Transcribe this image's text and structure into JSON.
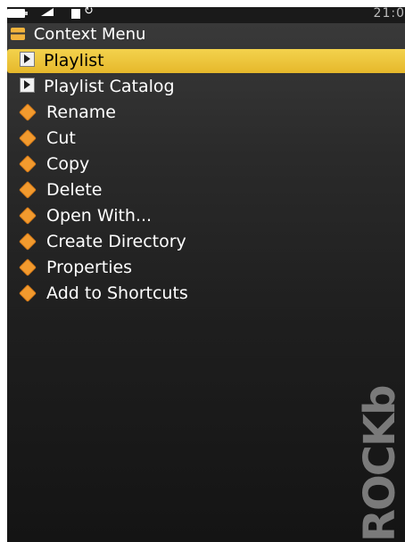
{
  "statusbar": {
    "clock": "21:0",
    "icons": [
      "battery-icon",
      "volume-icon",
      "hold-icon",
      "repeat-icon"
    ],
    "repeat_glyph": "↻"
  },
  "title": "Context Menu",
  "items": [
    {
      "label": "Playlist",
      "icon": "playlist-icon",
      "selected": true
    },
    {
      "label": "Playlist Catalog",
      "icon": "playlist-icon",
      "selected": false
    },
    {
      "label": "Rename",
      "icon": "action-icon",
      "selected": false
    },
    {
      "label": "Cut",
      "icon": "action-icon",
      "selected": false
    },
    {
      "label": "Copy",
      "icon": "action-icon",
      "selected": false
    },
    {
      "label": "Delete",
      "icon": "action-icon",
      "selected": false
    },
    {
      "label": "Open With...",
      "icon": "action-icon",
      "selected": false
    },
    {
      "label": "Create Directory",
      "icon": "action-icon",
      "selected": false
    },
    {
      "label": "Properties",
      "icon": "action-icon",
      "selected": false
    },
    {
      "label": "Add to Shortcuts",
      "icon": "action-icon",
      "selected": false
    }
  ],
  "logo_text": "ROCKbox",
  "colors": {
    "accent": "#e6b82b",
    "icon_orange": "#f29a2e",
    "menu_text": "#ffffff"
  }
}
